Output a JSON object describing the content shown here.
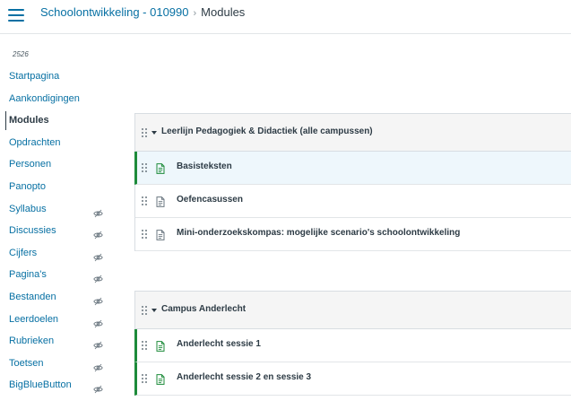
{
  "breadcrumb": {
    "course": "Schoolontwikkeling - 010990",
    "separator": "›",
    "current": "Modules"
  },
  "term": "2526",
  "sidebar": {
    "items": [
      {
        "label": "Startpagina",
        "hidden": false,
        "active": false
      },
      {
        "label": "Aankondigingen",
        "hidden": false,
        "active": false
      },
      {
        "label": "Modules",
        "hidden": false,
        "active": true
      },
      {
        "label": "Opdrachten",
        "hidden": false,
        "active": false
      },
      {
        "label": "Personen",
        "hidden": false,
        "active": false
      },
      {
        "label": "Panopto",
        "hidden": false,
        "active": false
      },
      {
        "label": "Syllabus",
        "hidden": true,
        "active": false
      },
      {
        "label": "Discussies",
        "hidden": true,
        "active": false
      },
      {
        "label": "Cijfers",
        "hidden": true,
        "active": false
      },
      {
        "label": "Pagina's",
        "hidden": true,
        "active": false
      },
      {
        "label": "Bestanden",
        "hidden": true,
        "active": false
      },
      {
        "label": "Leerdoelen",
        "hidden": true,
        "active": false
      },
      {
        "label": "Rubrieken",
        "hidden": true,
        "active": false
      },
      {
        "label": "Toetsen",
        "hidden": true,
        "active": false
      },
      {
        "label": "BigBlueButton",
        "hidden": true,
        "active": false
      }
    ]
  },
  "modules": [
    {
      "title": "Leerlijn Pedagogiek & Didactiek (alle campussen)",
      "items": [
        {
          "title": "Basisteksten",
          "published": true,
          "highlight": true
        },
        {
          "title": "Oefencasussen",
          "published": false,
          "highlight": false
        },
        {
          "title": "Mini-onderzoekskompas: mogelijke scenario's schoolontwikkeling",
          "published": false,
          "highlight": false
        }
      ]
    },
    {
      "title": "Campus Anderlecht",
      "items": [
        {
          "title": "Anderlecht sessie 1",
          "published": true,
          "highlight": false
        },
        {
          "title": "Anderlecht sessie 2 en sessie 3",
          "published": true,
          "highlight": false
        }
      ]
    }
  ],
  "colors": {
    "link": "#0770a3",
    "published": "#1d8b3a",
    "highlight": "#eef7fc",
    "header_bg": "#f5f5f5"
  },
  "icons": {
    "menu": "hamburger-menu-icon",
    "hidden": "eye-slash-icon",
    "drag": "drag-handle-icon",
    "expand": "caret-down-icon",
    "page": "document-page-icon"
  }
}
